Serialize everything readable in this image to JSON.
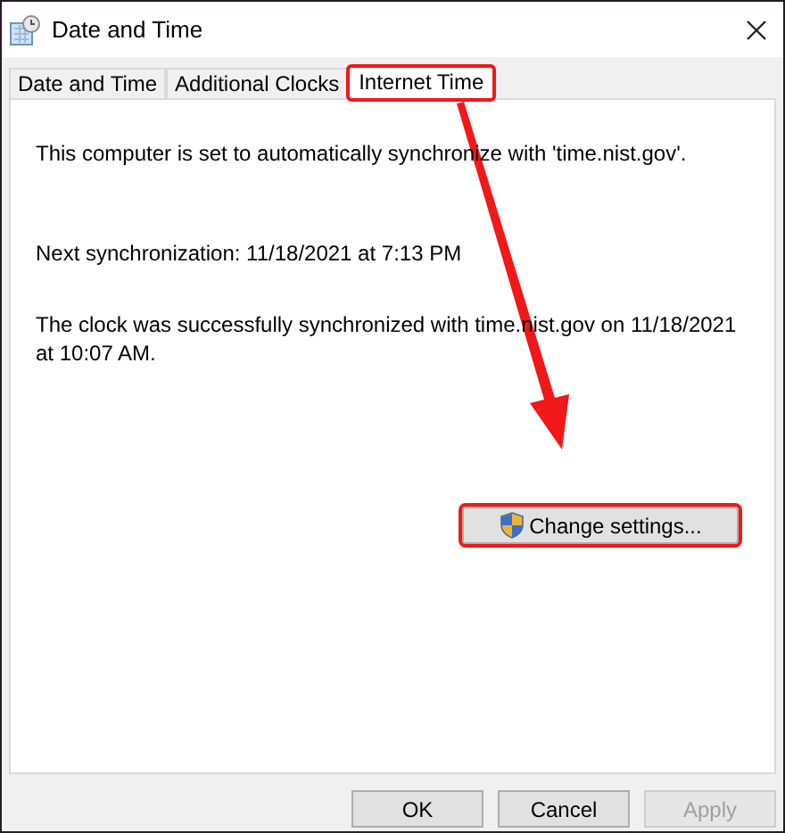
{
  "window": {
    "title": "Date and Time"
  },
  "tabs": [
    {
      "label": "Date and Time",
      "selected": false,
      "highlighted": false
    },
    {
      "label": "Additional Clocks",
      "selected": false,
      "highlighted": false
    },
    {
      "label": "Internet Time",
      "selected": true,
      "highlighted": true
    }
  ],
  "panel": {
    "status": "This computer is set to automatically synchronize with 'time.nist.gov'.",
    "next_sync": "Next synchronization: 11/18/2021 at 7:13 PM",
    "last_sync": "The clock was successfully synchronized with time.nist.gov on 11/18/2021 at 10:07 AM.",
    "change_button": {
      "label": "Change settings...",
      "highlighted": true
    }
  },
  "annotation_arrow": true,
  "buttons": [
    {
      "label": "OK",
      "disabled": false
    },
    {
      "label": "Cancel",
      "disabled": false
    },
    {
      "label": "Apply",
      "disabled": true
    }
  ]
}
